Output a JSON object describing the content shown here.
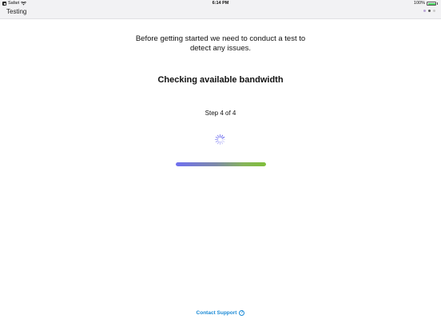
{
  "status_bar": {
    "back_app": "Safari",
    "back_badge": "◀",
    "time": "6:14 PM",
    "battery_percent": "100%",
    "battery_level": 1.0
  },
  "nav": {
    "title": "Testing",
    "page_dots": [
      {
        "color": "#b9a4d6"
      },
      {
        "color": "#555555"
      },
      {
        "color": "#c9c9c9"
      }
    ]
  },
  "main": {
    "intro_line1": "Before getting started we need to conduct a test to",
    "intro_line2": "detect any issues.",
    "heading": "Checking available bandwidth",
    "step": "Step 4 of 4",
    "progress": 1.0
  },
  "footer": {
    "support_label": "Contact Support",
    "help_glyph": "?"
  },
  "colors": {
    "accent": "#1b8ad6",
    "progress_start": "#6f6ff0",
    "progress_end": "#7fbf3a"
  }
}
